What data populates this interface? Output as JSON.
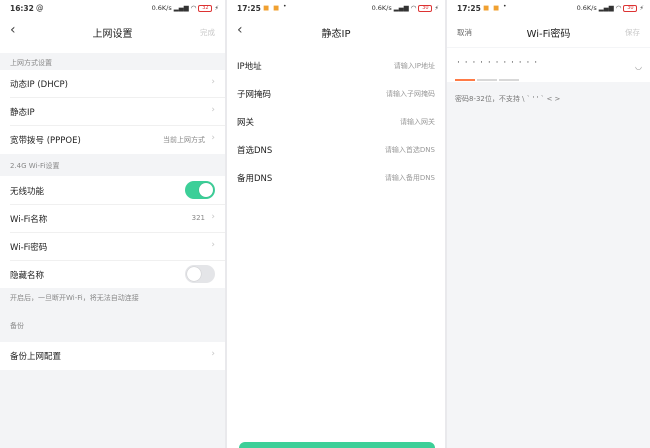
{
  "colors": {
    "accent": "#3ccf98",
    "strength_weak": "#ff7a45",
    "battery": "#dd3333"
  },
  "screen1": {
    "status": {
      "time": "16:32",
      "icon": "at-sign-icon",
      "speed": "0.6K/s",
      "battery": "32"
    },
    "nav": {
      "title": "上网设置",
      "right": "完成"
    },
    "section1_header": "上网方式设置",
    "connection_rows": [
      {
        "label": "动态IP (DHCP)"
      },
      {
        "label": "静态IP"
      },
      {
        "label": "宽带拨号 (PPPOE)",
        "value": "当前上网方式"
      }
    ],
    "section2_header": "2.4G Wi-Fi设置",
    "wireless": {
      "label": "无线功能",
      "on": true
    },
    "wifi_name": {
      "label": "Wi-Fi名称",
      "value": "321"
    },
    "wifi_password": {
      "label": "Wi-Fi密码"
    },
    "hide_name": {
      "label": "隐藏名称",
      "on": false
    },
    "hide_note": "开启后，一旦断开Wi-Fi，将无法自动连接",
    "backup_header": "备份",
    "backup_row": {
      "label": "备份上网配置"
    }
  },
  "screen2": {
    "status": {
      "time": "17:25",
      "speed": "0.6K/s",
      "battery": "30"
    },
    "nav": {
      "title": "静态IP"
    },
    "fields": [
      {
        "label": "IP地址",
        "placeholder": "请输入IP地址"
      },
      {
        "label": "子网掩码",
        "placeholder": "请输入子网掩码"
      },
      {
        "label": "网关",
        "placeholder": "请输入网关"
      },
      {
        "label": "首选DNS",
        "placeholder": "请输入首选DNS"
      },
      {
        "label": "备用DNS",
        "placeholder": "请输入备用DNS"
      }
    ]
  },
  "screen3": {
    "status": {
      "time": "17:25",
      "speed": "0.6K/s",
      "battery": "30"
    },
    "nav": {
      "title": "Wi-Fi密码",
      "left": "取消",
      "right": "保存"
    },
    "password_mask": "· · · · · · · · · · ·",
    "strength_level": 1,
    "strength_total": 3,
    "hint": "密码8-32位，不支持 \\ ` ' ' ` < >"
  }
}
